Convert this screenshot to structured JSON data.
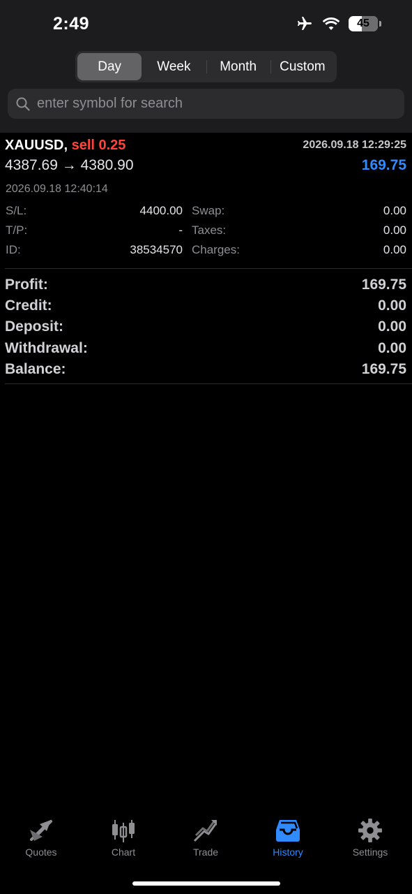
{
  "status_bar": {
    "time": "2:49",
    "battery": "45",
    "battery_level": 0.45,
    "icons": [
      "airplane-icon",
      "wifi-icon",
      "battery-icon"
    ]
  },
  "period_tabs": [
    "Day",
    "Week",
    "Month",
    "Custom"
  ],
  "selected_period": "Day",
  "search": {
    "placeholder": "enter symbol for search",
    "value": ""
  },
  "deal": {
    "symbol": "XAUUSD,",
    "side": "sell 0.25",
    "open_time": "2026.09.18 12:29:25",
    "open_price": "4387.69",
    "arrow": "→",
    "close_price": "4380.90",
    "profit": "169.75",
    "close_time": "2026.09.18 12:40:14",
    "details_left": [
      {
        "label": "S/L:",
        "value": "4400.00"
      },
      {
        "label": "T/P:",
        "value": "-"
      },
      {
        "label": "ID:",
        "value": "38534570"
      }
    ],
    "details_right": [
      {
        "label": "Swap:",
        "value": "0.00"
      },
      {
        "label": "Taxes:",
        "value": "0.00"
      },
      {
        "label": "Charges:",
        "value": "0.00"
      }
    ]
  },
  "summary": [
    {
      "label": "Profit:",
      "value": "169.75"
    },
    {
      "label": "Credit:",
      "value": "0.00"
    },
    {
      "label": "Deposit:",
      "value": "0.00"
    },
    {
      "label": "Withdrawal:",
      "value": "0.00"
    },
    {
      "label": "Balance:",
      "value": "169.75"
    }
  ],
  "tabbar": {
    "items": [
      {
        "label": "Quotes",
        "icon": "quotes-icon"
      },
      {
        "label": "Chart",
        "icon": "candlestick-chart-icon"
      },
      {
        "label": "Trade",
        "icon": "trade-icon"
      },
      {
        "label": "History",
        "icon": "history-inbox-icon"
      },
      {
        "label": "Settings",
        "icon": "gear-icon"
      }
    ],
    "active": "History"
  },
  "colors": {
    "accent": "#2f8bff",
    "sell": "#ff453a",
    "background": "#000000",
    "header": "#1c1c1e"
  }
}
